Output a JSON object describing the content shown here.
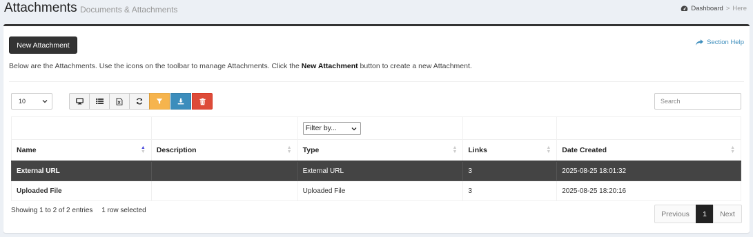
{
  "header": {
    "title": "Attachments",
    "subtitle": "Documents & Attachments",
    "breadcrumb": {
      "dashboard": "Dashboard",
      "separator": ">",
      "here": "Here"
    }
  },
  "actions": {
    "new_attachment": "New Attachment",
    "section_help": "Section Help"
  },
  "intro": {
    "before": "Below are the Attachments. Use the icons on the toolbar to manage Attachments. Click the ",
    "bold": "New Attachment",
    "after": " button to create a new Attachment."
  },
  "length_select": {
    "value": "10"
  },
  "toolbar": {
    "icons": [
      "monitor-icon",
      "list-icon",
      "excel-file-icon",
      "refresh-icon",
      "filter-icon",
      "download-icon",
      "trash-icon"
    ],
    "colors": {
      "filter": "#f39c12",
      "download": "#3c8dbc",
      "delete": "#dd4b39"
    }
  },
  "search": {
    "placeholder": "Search"
  },
  "filter": {
    "type_value": "Filter by..."
  },
  "table": {
    "columns": [
      "Name",
      "Description",
      "Type",
      "Links",
      "Date Created"
    ],
    "rows": [
      {
        "name": "External URL",
        "description": "",
        "type": "External URL",
        "links": "3",
        "date_created": "2025-08-25 18:01:32",
        "selected": true
      },
      {
        "name": "Uploaded File",
        "description": "",
        "type": "Uploaded File",
        "links": "3",
        "date_created": "2025-08-25 18:20:16",
        "selected": false
      }
    ]
  },
  "footer": {
    "info": "Showing 1 to 2 of 2 entries",
    "selected": "1 row selected"
  },
  "pagination": {
    "previous": "Previous",
    "current": "1",
    "next": "Next"
  }
}
